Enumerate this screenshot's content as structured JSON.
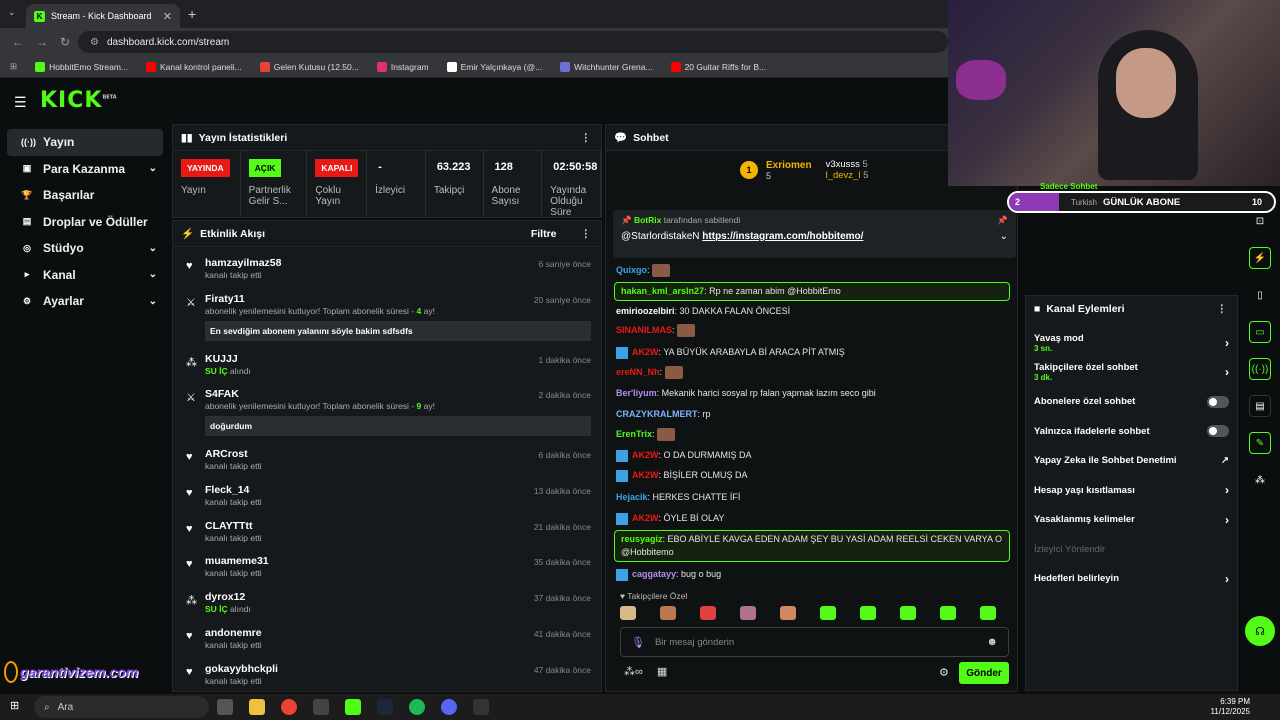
{
  "browser": {
    "tab_title": "Stream - Kick Dashboard",
    "url": "dashboard.kick.com/stream",
    "bookmarks": [
      {
        "label": "HobbitEmo Stream...",
        "color": "#53fc18"
      },
      {
        "label": "Kanal kontrol paneli...",
        "color": "#ff0000"
      },
      {
        "label": "Gelen Kutusu (12.50...",
        "color": "#ea4335"
      },
      {
        "label": "Instagram",
        "color": "#e1306c"
      },
      {
        "label": "Emir Yalçınkaya (@...",
        "color": "#ffffff"
      },
      {
        "label": "Witchhunter Grena...",
        "color": "#6f6fd8"
      },
      {
        "label": "20 Guitar Riffs for B...",
        "color": "#ff0000"
      }
    ]
  },
  "brand": {
    "logo": "KICK",
    "beta": "BETA"
  },
  "sidebar": {
    "items": [
      {
        "label": "Yayın",
        "icon": "broadcast-icon",
        "glyph": "((·))",
        "active": true,
        "caret": false
      },
      {
        "label": "Para Kazanma",
        "icon": "wallet-icon",
        "glyph": "▣",
        "active": false,
        "caret": true
      },
      {
        "label": "Başarılar",
        "icon": "trophy-icon",
        "glyph": "🏆",
        "active": false,
        "caret": false
      },
      {
        "label": "Droplar ve Ödüller",
        "icon": "gift-icon",
        "glyph": "▤",
        "active": false,
        "caret": false
      },
      {
        "label": "Stüdyo",
        "icon": "studio-icon",
        "glyph": "◎",
        "active": false,
        "caret": true
      },
      {
        "label": "Kanal",
        "icon": "channel-icon",
        "glyph": "▸",
        "active": false,
        "caret": true
      },
      {
        "label": "Ayarlar",
        "icon": "gear-icon",
        "glyph": "⚙",
        "active": false,
        "caret": true
      }
    ]
  },
  "stats": {
    "title": "Yayın İstatistikleri",
    "cells": [
      {
        "badge": "YAYINDA",
        "badge_type": "red",
        "label": "Yayın"
      },
      {
        "badge": "AÇIK",
        "badge_type": "green",
        "label": "Partnerlik Gelir S..."
      },
      {
        "badge": "KAPALI",
        "badge_type": "red",
        "label": "Çoklu Yayın"
      },
      {
        "value": "-",
        "label": "İzleyici"
      },
      {
        "value": "63.223",
        "label": "Takipçi"
      },
      {
        "value": "128",
        "label": "Abone Sayısı"
      },
      {
        "value": "02:50:58",
        "label": "Yayında Olduğu Süre"
      }
    ]
  },
  "feed": {
    "title": "Etkinlik Akışı",
    "filter": "Filtre",
    "items": [
      {
        "name": "hamzayilmaz58",
        "sub": "kanalı takip etti",
        "time": "6 saniye önce",
        "icon": "heart-icon"
      },
      {
        "name": "Firaty11",
        "sub": "abonelik yenilemesini kutluyor! Toplam abonelik süresi - ",
        "sub_hl": "4",
        "sub_end": " ay!",
        "msg": "En sevdiğim abonem yalanını söyle bakim sdfsdfs",
        "time": "20 saniye önce",
        "icon": "star-icon"
      },
      {
        "name": "KUJJJ",
        "sub_green": "SU İÇ",
        "sub": " alındı",
        "time": "1 dakika önce",
        "icon": "drops-icon"
      },
      {
        "name": "S4FAK",
        "sub": "abonelik yenilemesini kutluyor! Toplam abonelik süresi - ",
        "sub_hl": "9",
        "sub_end": " ay!",
        "msg": "doğurdum",
        "time": "2 dakika önce",
        "icon": "star-icon"
      },
      {
        "name": "ARCrost",
        "sub": "kanalı takip etti",
        "time": "6 dakika önce",
        "icon": "heart-icon"
      },
      {
        "name": "Fleck_14",
        "sub": "kanalı takip etti",
        "time": "13 dakika önce",
        "icon": "heart-icon"
      },
      {
        "name": "CLAYTTtt",
        "sub": "kanalı takip etti",
        "time": "21 dakika önce",
        "icon": "heart-icon"
      },
      {
        "name": "muameme31",
        "sub": "kanalı takip etti",
        "time": "35 dakika önce",
        "icon": "heart-icon"
      },
      {
        "name": "dyrox12",
        "sub_green": "SU İÇ",
        "sub": " alındı",
        "time": "37 dakika önce",
        "icon": "drops-icon"
      },
      {
        "name": "andonemre",
        "sub": "kanalı takip etti",
        "time": "41 dakika önce",
        "icon": "heart-icon"
      },
      {
        "name": "gokayybhckpli",
        "sub": "kanalı takip etti",
        "time": "47 dakika önce",
        "icon": "heart-icon"
      }
    ]
  },
  "chat": {
    "title": "Sohbet",
    "leader": {
      "rank": "1",
      "name": "Exriomen",
      "count": "5"
    },
    "leader2": [
      {
        "name": "v3xusss",
        "count": "5"
      },
      {
        "name": "l_devz_l",
        "count": "5"
      }
    ],
    "pinned": {
      "by": "BotRix",
      "by_suffix": " tarafından sabitlendi",
      "user": "@StarlordistakeN",
      "link": "https://instagram.com/hobbitemo/"
    },
    "messages": [
      {
        "user": "Quixgo",
        "color": "#3da1e8",
        "text": "",
        "emote": true,
        "highlight": false,
        "mod": false
      },
      {
        "user": "hakan_kml_arsln27",
        "color": "#53fc18",
        "text": "Rp ne zaman abim @HobbitEmo",
        "emote": false,
        "highlight": true,
        "mod": false
      },
      {
        "user": "emirioozelbiri",
        "color": "#ffffff",
        "text": "30 DAKKA FALAN ÖNCESİ",
        "emote": false,
        "highlight": false,
        "mod": false
      },
      {
        "user": "SINANILMAS",
        "color": "#e91916",
        "text": "",
        "emote": true,
        "highlight": false,
        "mod": false
      },
      {
        "user": "AK2W",
        "color": "#e91916",
        "text": "YA BÜYÜK ARABAYLA Bİ ARACA PİT ATMIŞ",
        "emote": false,
        "highlight": false,
        "mod": true
      },
      {
        "user": "ereNN_Nh",
        "color": "#e91916",
        "text": "",
        "emote": true,
        "highlight": false,
        "mod": false
      },
      {
        "user": "Ber'liyum",
        "color": "#b58cf5",
        "text": "Mekanik harici sosyal rp falan yapmak lazım seco gibi",
        "emote": false,
        "highlight": false,
        "mod": false
      },
      {
        "user": "CRAZYKRALMERT",
        "color": "#7fb2ff",
        "text": "rp",
        "emote": false,
        "highlight": false,
        "mod": false
      },
      {
        "user": "ErenTrix",
        "color": "#53fc18",
        "text": "",
        "emote": true,
        "highlight": false,
        "mod": false
      },
      {
        "user": "AK2W",
        "color": "#e91916",
        "text": "O DA DURMAMIŞ DA",
        "emote": false,
        "highlight": false,
        "mod": true
      },
      {
        "user": "AK2W",
        "color": "#e91916",
        "text": "BİŞİLER OLMUŞ DA",
        "emote": false,
        "highlight": false,
        "mod": true
      },
      {
        "user": "Hejacik",
        "color": "#3da1e8",
        "text": "HERKES CHATTE İFİ",
        "emote": false,
        "highlight": false,
        "mod": false
      },
      {
        "user": "AK2W",
        "color": "#e91916",
        "text": "ÖYLE Bİ OLAY",
        "emote": false,
        "highlight": false,
        "mod": true
      },
      {
        "user": "reusyagiz",
        "color": "#53fc18",
        "text": "EBO ABİYLE KAVGA EDEN ADAM ŞEY BU YASİ ADAM REELSİ CEKEN VARYA O @Hobbitemo",
        "emote": false,
        "highlight": true,
        "mod": false
      },
      {
        "user": "caggatayy",
        "color": "#b58cf5",
        "text": "bug o bug",
        "emote": false,
        "highlight": false,
        "mod": true
      }
    ],
    "follower_only": "Takipçilere Özel",
    "placeholder": "Bir mesaj gönderin",
    "send": "Gönder"
  },
  "actions": {
    "title": "Kanal Eylemleri",
    "items": [
      {
        "label": "Yavaş mod",
        "sub": "3 sn.",
        "control": "arrow"
      },
      {
        "label": "Takipçilere özel sohbet",
        "sub": "3 dk.",
        "control": "arrow"
      },
      {
        "label": "Abonelere özel sohbet",
        "sub": "",
        "control": "toggle"
      },
      {
        "label": "Yalnızca ifadelerle sohbet",
        "sub": "",
        "control": "toggle"
      },
      {
        "label": "Yapay Zeka ile Sohbet Denetimi",
        "sub": "",
        "control": "external"
      },
      {
        "label": "Hesap yaşı kısıtlaması",
        "sub": "",
        "control": "arrow"
      },
      {
        "label": "Yasaklanmış kelimeler",
        "sub": "",
        "control": "arrow"
      },
      {
        "label": "İzleyici Yönlendir",
        "sub": "",
        "control": "none",
        "disabled": true
      },
      {
        "label": "Hedefleri belirleyin",
        "sub": "",
        "control": "arrow"
      }
    ]
  },
  "overlay": {
    "sub_count": "2",
    "language": "Turkish",
    "goal": "GÜNLÜK ABONE",
    "goal_target": "10",
    "watermark": "garantivizem.com",
    "top_text": "Sadece Sohbet"
  },
  "taskbar": {
    "search": "Ara",
    "time": "6:39 PM",
    "date": "11/12/2025"
  }
}
